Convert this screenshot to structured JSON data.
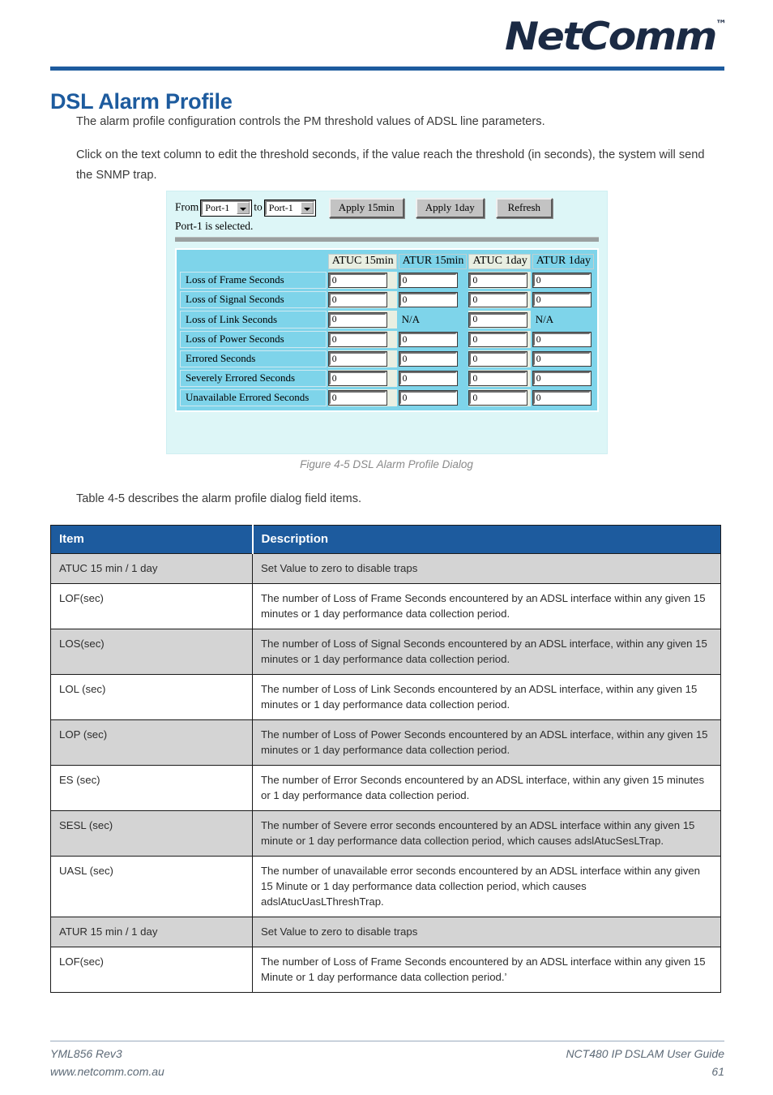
{
  "header": {
    "logo_text": "NetComm",
    "logo_tm": "™"
  },
  "page_title": "DSL Alarm Profile",
  "body": {
    "paragraph_1": "The alarm profile configuration controls the PM threshold values of ADSL line parameters.",
    "paragraph_2": "Click on the text column to edit the threshold seconds, if the value reach the threshold (in seconds), the system will send the SNMP trap."
  },
  "figure": {
    "caption": "Figure 4-5 DSL Alarm Profile Dialog",
    "toolbar": {
      "from_label": "From",
      "to_label": "to",
      "from_select_value": "Port-1",
      "to_select_value": "Port-1",
      "apply_15min_button": "Apply 15min",
      "apply_1day_button": "Apply 1day",
      "refresh_button": "Refresh",
      "status_text": "Port-1 is selected."
    },
    "table": {
      "headers": [
        "",
        "ATUC 15min",
        "ATUR 15min",
        "ATUC 1day",
        "ATUR 1day"
      ],
      "rows": [
        {
          "label": "Loss of Frame Seconds",
          "values": [
            "0",
            "0",
            "0",
            "0"
          ],
          "types": [
            "input",
            "input",
            "input",
            "input"
          ]
        },
        {
          "label": "Loss of Signal Seconds",
          "values": [
            "0",
            "0",
            "0",
            "0"
          ],
          "types": [
            "input",
            "input",
            "input",
            "input"
          ]
        },
        {
          "label": "Loss of Link Seconds",
          "values": [
            "0",
            "N/A",
            "0",
            "N/A"
          ],
          "types": [
            "input",
            "text",
            "input",
            "text"
          ]
        },
        {
          "label": "Loss of Power Seconds",
          "values": [
            "0",
            "0",
            "0",
            "0"
          ],
          "types": [
            "input",
            "input",
            "input",
            "input"
          ]
        },
        {
          "label": "Errored Seconds",
          "values": [
            "0",
            "0",
            "0",
            "0"
          ],
          "types": [
            "input",
            "input",
            "input",
            "input"
          ]
        },
        {
          "label": "Severely Errored Seconds",
          "values": [
            "0",
            "0",
            "0",
            "0"
          ],
          "types": [
            "input",
            "input",
            "input",
            "input"
          ]
        },
        {
          "label": "Unavailable Errored Seconds",
          "values": [
            "0",
            "0",
            "0",
            "0"
          ],
          "types": [
            "input",
            "input",
            "input",
            "input"
          ]
        }
      ]
    }
  },
  "table_intro": "Table 4-5 describes the alarm profile dialog field items.",
  "doc_table": {
    "headers": [
      "Item",
      "Description"
    ],
    "rows": [
      {
        "item": "ATUC 15 min / 1 day",
        "description": "Set Value to zero to disable traps",
        "shaded": true
      },
      {
        "item": "LOF(sec)",
        "description": "The number of Loss of Frame Seconds encountered by an ADSL interface within any given 15 minutes or 1 day performance data collection period.",
        "shaded": false
      },
      {
        "item": "LOS(sec)",
        "description": "The number of Loss of Signal Seconds encountered by an ADSL interface, within any given 15 minutes or 1 day performance data collection period.",
        "shaded": true
      },
      {
        "item": "LOL (sec)",
        "description": "The number of Loss of Link Seconds encountered by an ADSL interface, within any given 15 minutes or 1 day performance data collection period.",
        "shaded": false
      },
      {
        "item": "LOP (sec)",
        "description": "The number of Loss of Power Seconds encountered by an ADSL interface, within any given 15 minutes or 1 day performance data collection period.",
        "shaded": true
      },
      {
        "item": "ES (sec)",
        "description": "The number of Error Seconds encountered by an ADSL interface, within any given 15 minutes or 1 day performance data collection period.",
        "shaded": false
      },
      {
        "item": "SESL (sec)",
        "description": "The number of Severe error seconds encountered by an ADSL interface within any given 15 minute or 1 day performance data collection period, which causes adslAtucSesLTrap.",
        "shaded": true
      },
      {
        "item": "UASL (sec)",
        "description": "The number of unavailable error seconds encountered by an ADSL interface within any given 15 Minute or 1 day performance data collection period, which causes adslAtucUasLThreshTrap.",
        "shaded": false
      },
      {
        "item": "ATUR 15 min / 1 day",
        "description": "Set Value to zero to disable traps",
        "shaded": true
      },
      {
        "item": "LOF(sec)",
        "description": "The number of Loss of Frame Seconds encountered by an ADSL interface within any given 15 Minute or 1 day performance data collection period.’",
        "shaded": false
      }
    ]
  },
  "footer": {
    "left_line_1": "YML856 Rev3",
    "left_line_2": "www.netcomm.com.au",
    "right_line_1": "NCT480 IP DSLAM User Guide",
    "right_line_2": "61"
  },
  "colors": {
    "brand_blue": "#1d5b9e",
    "dialog_bg": "#ddf6f7",
    "atuc_cell": "#e9efe2",
    "atur_cell": "#7ed4ea",
    "table_shaded": "#d4d4d4"
  }
}
